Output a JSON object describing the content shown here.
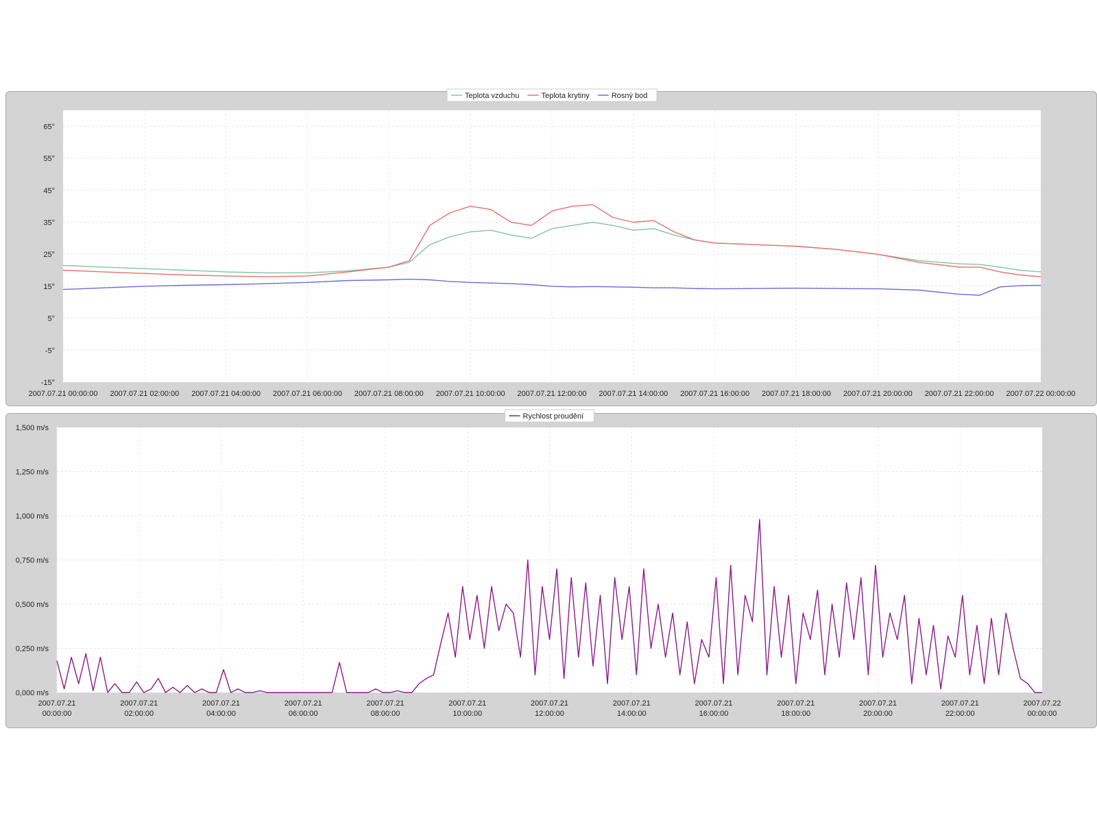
{
  "chart_data": [
    {
      "type": "line",
      "title": "",
      "xlabel": "",
      "ylabel": "",
      "ylim": [
        -15,
        70
      ],
      "y_ticks": [
        "65°",
        "55°",
        "45°",
        "35°",
        "25°",
        "15°",
        "5°",
        "-5°",
        "-15°"
      ],
      "y_tick_values": [
        65,
        55,
        45,
        35,
        25,
        15,
        5,
        -5,
        -15
      ],
      "x_ticks": [
        "2007.07.21 00:00:00",
        "2007.07.21 02:00:00",
        "2007.07.21 04:00:00",
        "2007.07.21 06:00:00",
        "2007.07.21 08:00:00",
        "2007.07.21 10:00:00",
        "2007.07.21 12:00:00",
        "2007.07.21 14:00:00",
        "2007.07.21 16:00:00",
        "2007.07.21 18:00:00",
        "2007.07.21 20:00:00",
        "2007.07.21 22:00:00",
        "2007.07.22 00:00:00"
      ],
      "x_hours": [
        "00:00",
        "01:00",
        "02:00",
        "03:00",
        "04:00",
        "05:00",
        "06:00",
        "07:00",
        "08:00",
        "08:30",
        "09:00",
        "09:30",
        "10:00",
        "10:30",
        "11:00",
        "11:30",
        "12:00",
        "12:30",
        "13:00",
        "13:30",
        "14:00",
        "14:30",
        "15:00",
        "15:30",
        "16:00",
        "17:00",
        "18:00",
        "19:00",
        "20:00",
        "21:00",
        "22:00",
        "22:30",
        "23:00",
        "23:30",
        "24:00"
      ],
      "grid": true,
      "legend": "top-center",
      "series": [
        {
          "name": "Teplota vzduchu",
          "color": "#7fc6a4",
          "values": [
            21.5,
            21,
            20.5,
            20,
            19.5,
            19.2,
            19.2,
            19.8,
            21,
            22.5,
            28,
            30.5,
            32,
            32.5,
            31,
            30,
            33,
            34,
            35,
            34,
            32.5,
            33,
            31,
            29.5,
            28.5,
            28,
            27.5,
            26.5,
            25,
            23,
            22,
            21.8,
            21,
            20,
            19.5
          ]
        },
        {
          "name": "Teplota krytiny",
          "color": "#e8706a",
          "values": [
            20,
            19.5,
            19,
            18.5,
            18.2,
            18,
            18.2,
            19.5,
            21,
            23,
            34,
            38,
            40,
            39,
            35,
            34,
            38.5,
            40,
            40.5,
            36.5,
            35,
            35.5,
            32,
            29.5,
            28.5,
            28,
            27.5,
            26.5,
            25,
            22.5,
            21,
            21,
            19.5,
            18.5,
            18
          ]
        },
        {
          "name": "Rosný bod",
          "color": "#6b6bdf",
          "values": [
            14,
            14.5,
            15,
            15.3,
            15.5,
            15.8,
            16.2,
            16.8,
            17,
            17.2,
            17,
            16.5,
            16.2,
            16,
            15.8,
            15.5,
            15,
            14.8,
            14.9,
            14.8,
            14.7,
            14.5,
            14.5,
            14.3,
            14.2,
            14.3,
            14.4,
            14.3,
            14.2,
            13.8,
            12.5,
            12.2,
            14.8,
            15.2,
            15.3
          ]
        }
      ]
    },
    {
      "type": "line",
      "title": "",
      "xlabel": "",
      "ylabel": "",
      "ylim": [
        0,
        1.5
      ],
      "y_ticks": [
        "1,500 m/s",
        "1,250 m/s",
        "1,000 m/s",
        "0,750 m/s",
        "0,500 m/s",
        "0,250 m/s",
        "0,000 m/s"
      ],
      "y_tick_values": [
        1.5,
        1.25,
        1.0,
        0.75,
        0.5,
        0.25,
        0
      ],
      "x_ticks": [
        [
          "2007.07.21",
          "00:00:00"
        ],
        [
          "2007.07.21",
          "02:00:00"
        ],
        [
          "2007.07.21",
          "04:00:00"
        ],
        [
          "2007.07.21",
          "06:00:00"
        ],
        [
          "2007.07.21",
          "08:00:00"
        ],
        [
          "2007.07.21",
          "10:00:00"
        ],
        [
          "2007.07.21",
          "12:00:00"
        ],
        [
          "2007.07.21",
          "14:00:00"
        ],
        [
          "2007.07.21",
          "16:00:00"
        ],
        [
          "2007.07.21",
          "18:00:00"
        ],
        [
          "2007.07.21",
          "20:00:00"
        ],
        [
          "2007.07.21",
          "22:00:00"
        ],
        [
          "2007.07.22",
          "00:00:00"
        ]
      ],
      "grid": true,
      "legend": "top-center",
      "series": [
        {
          "name": "Rychlost proudění",
          "color": "#8b1a8b",
          "values": [
            0.18,
            0.02,
            0.2,
            0.05,
            0.22,
            0.01,
            0.2,
            0.0,
            0.05,
            0.0,
            0.0,
            0.06,
            0.0,
            0.02,
            0.08,
            0.0,
            0.03,
            0.0,
            0.04,
            0.0,
            0.02,
            0.0,
            0.0,
            0.13,
            0.0,
            0.02,
            0.0,
            0.0,
            0.01,
            0.0,
            0.0,
            0.0,
            0.0,
            0.0,
            0.0,
            0.0,
            0.0,
            0.0,
            0.0,
            0.17,
            0.0,
            0.0,
            0.0,
            0.0,
            0.02,
            0.0,
            0.0,
            0.01,
            0.0,
            0.0,
            0.05,
            0.08,
            0.1,
            0.28,
            0.45,
            0.2,
            0.6,
            0.3,
            0.55,
            0.25,
            0.6,
            0.35,
            0.5,
            0.45,
            0.2,
            0.75,
            0.1,
            0.6,
            0.3,
            0.7,
            0.08,
            0.65,
            0.2,
            0.62,
            0.15,
            0.55,
            0.05,
            0.65,
            0.3,
            0.6,
            0.1,
            0.7,
            0.25,
            0.5,
            0.2,
            0.45,
            0.1,
            0.4,
            0.05,
            0.3,
            0.2,
            0.65,
            0.05,
            0.72,
            0.1,
            0.55,
            0.4,
            0.98,
            0.1,
            0.6,
            0.2,
            0.55,
            0.05,
            0.45,
            0.3,
            0.58,
            0.1,
            0.5,
            0.2,
            0.62,
            0.3,
            0.65,
            0.1,
            0.72,
            0.2,
            0.45,
            0.3,
            0.55,
            0.05,
            0.42,
            0.1,
            0.38,
            0.02,
            0.32,
            0.2,
            0.55,
            0.1,
            0.38,
            0.05,
            0.42,
            0.1,
            0.45,
            0.25,
            0.08,
            0.05,
            0.0,
            0.0
          ]
        }
      ]
    }
  ]
}
